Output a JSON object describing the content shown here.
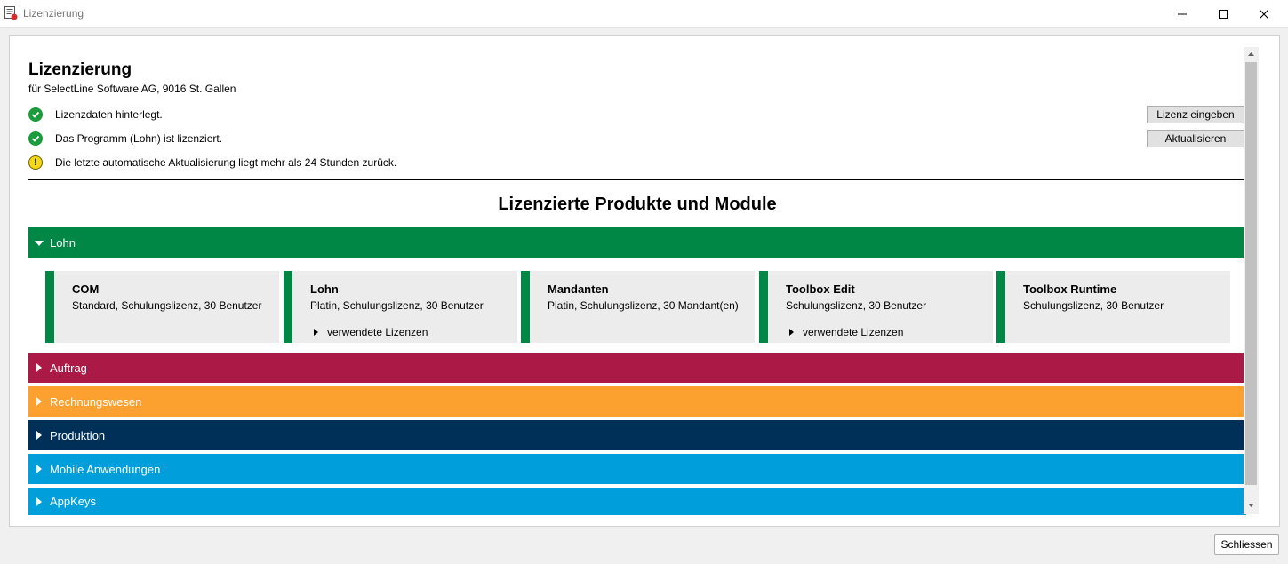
{
  "window": {
    "title": "Lizenzierung",
    "app_icon": "license-document-icon"
  },
  "header": {
    "title": "Lizenzierung",
    "subtitle": "für SelectLine Software AG, 9016 St. Gallen"
  },
  "status": [
    {
      "type": "ok",
      "icon": "checkmark-circle-icon",
      "text": "Lizenzdaten hinterlegt."
    },
    {
      "type": "ok",
      "icon": "checkmark-circle-icon",
      "text": "Das Programm (Lohn) ist lizenziert."
    },
    {
      "type": "warning",
      "icon": "warning-icon",
      "text": "Die letzte automatische Aktualisierung liegt mehr als 24 Stunden zurück."
    }
  ],
  "buttons": {
    "enter_license": "Lizenz eingeben",
    "refresh": "Aktualisieren",
    "close": "Schliessen"
  },
  "section_title": "Lizenzierte Produkte und Module",
  "groups": [
    {
      "label": "Lohn",
      "color": "#008746",
      "expanded": true
    },
    {
      "label": "Auftrag",
      "color": "#ab1a46",
      "expanded": false
    },
    {
      "label": "Rechnungswesen",
      "color": "#fca130",
      "expanded": false
    },
    {
      "label": "Produktion",
      "color": "#002f57",
      "expanded": false
    },
    {
      "label": "Mobile Anwendungen",
      "color": "#009fdb",
      "expanded": false
    },
    {
      "label": "AppKeys",
      "color": "#009fdb",
      "expanded": false
    }
  ],
  "cards": [
    {
      "name": "COM",
      "desc": "Standard, Schulungslizenz, 30 Benutzer",
      "used": ""
    },
    {
      "name": "Lohn",
      "desc": "Platin, Schulungslizenz, 30 Benutzer",
      "used": "verwendete Lizenzen"
    },
    {
      "name": "Mandanten",
      "desc": "Platin, Schulungslizenz, 30 Mandant(en)",
      "used": ""
    },
    {
      "name": "Toolbox Edit",
      "desc": "Schulungslizenz, 30 Benutzer",
      "used": "verwendete Lizenzen"
    },
    {
      "name": "Toolbox Runtime",
      "desc": "Schulungslizenz, 30 Benutzer",
      "used": ""
    }
  ]
}
